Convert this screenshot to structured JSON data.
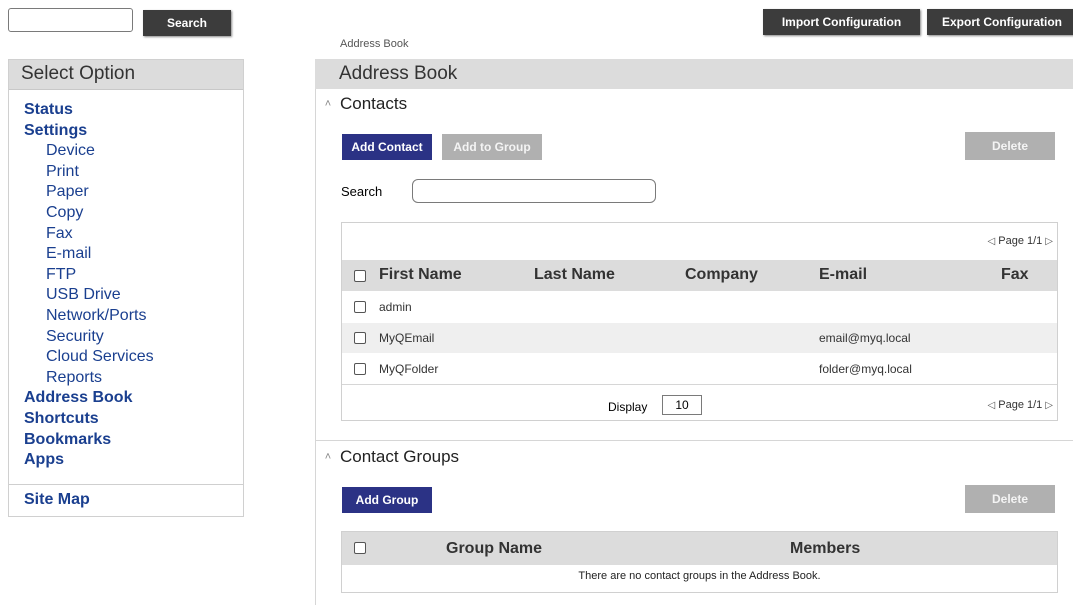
{
  "top": {
    "search_placeholder": "",
    "search_button": "Search",
    "import_button": "Import Configuration",
    "export_button": "Export Configuration"
  },
  "breadcrumb": "Address Book",
  "sidebar": {
    "title": "Select Option",
    "items": [
      {
        "label": "Status",
        "level": 0
      },
      {
        "label": "Settings",
        "level": 0
      },
      {
        "label": "Device",
        "level": 1
      },
      {
        "label": "Print",
        "level": 1
      },
      {
        "label": "Paper",
        "level": 1
      },
      {
        "label": "Copy",
        "level": 1
      },
      {
        "label": "Fax",
        "level": 1
      },
      {
        "label": "E-mail",
        "level": 1
      },
      {
        "label": "FTP",
        "level": 1
      },
      {
        "label": "USB Drive",
        "level": 1
      },
      {
        "label": "Network/Ports",
        "level": 1
      },
      {
        "label": "Security",
        "level": 1
      },
      {
        "label": "Cloud Services",
        "level": 1
      },
      {
        "label": "Reports",
        "level": 1
      },
      {
        "label": "Address Book",
        "level": 0
      },
      {
        "label": "Shortcuts",
        "level": 0
      },
      {
        "label": "Bookmarks",
        "level": 0
      },
      {
        "label": "Apps",
        "level": 0
      }
    ],
    "site_map": "Site Map"
  },
  "main": {
    "title": "Address Book",
    "contacts": {
      "title": "Contacts",
      "add_contact": "Add Contact",
      "add_to_group": "Add to Group",
      "delete": "Delete",
      "search_label": "Search",
      "search_value": "",
      "pager": "Page 1/1",
      "columns": [
        "First Name",
        "Last Name",
        "Company",
        "E-mail",
        "Fax"
      ],
      "rows": [
        {
          "first": "admin",
          "last": "",
          "company": "",
          "email": "",
          "fax": ""
        },
        {
          "first": "MyQEmail",
          "last": "",
          "company": "",
          "email": "email@myq.local",
          "fax": ""
        },
        {
          "first": "MyQFolder",
          "last": "",
          "company": "",
          "email": "folder@myq.local",
          "fax": ""
        }
      ],
      "display_label": "Display",
      "display_value": "10"
    },
    "groups": {
      "title": "Contact Groups",
      "add_group": "Add Group",
      "delete": "Delete",
      "columns": [
        "Group Name",
        "Members"
      ],
      "empty_message": "There are no contact groups in the Address Book."
    }
  }
}
